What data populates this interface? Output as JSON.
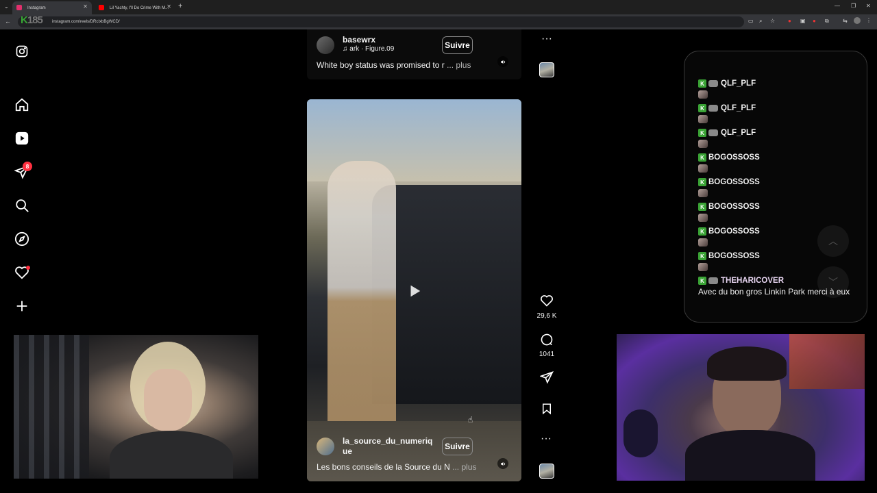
{
  "browser": {
    "tabs": [
      {
        "title": "Instagram",
        "active": true,
        "favicon_color": "#e1306c"
      },
      {
        "title": "Lil Yachty, I'll Do Crime With M...",
        "active": false,
        "favicon_color": "#ff0000"
      }
    ],
    "url": "instagram.com/reels/DRcIxbBgWCD/",
    "overlay_logo": "K",
    "overlay_text": "185"
  },
  "sidebar": {
    "icons": [
      "instagram-logo-icon",
      "home-icon",
      "reels-icon",
      "messages-icon",
      "search-icon",
      "explore-icon",
      "notifications-icon",
      "create-icon"
    ],
    "messages_badge": "8"
  },
  "reel_top": {
    "username": "basewrx",
    "audio_text": "ark · Figure.09",
    "follow_label": "Suivre",
    "caption": "White boy status was promised to r",
    "more_label": "... plus"
  },
  "reel_main": {
    "username": "la_source_du_numerique",
    "follow_label": "Suivre",
    "caption": "Les bons conseils de la Source du N",
    "more_label": "... plus",
    "likes": "29,6 K",
    "comments": "1041"
  },
  "chat": {
    "rows": [
      {
        "user": "QLF_PLF",
        "emote": true
      },
      {
        "user": "QLF_PLF",
        "emote": true
      },
      {
        "user": "QLF_PLF",
        "emote": true
      },
      {
        "user": "BOGOSSOSS",
        "emote": false
      },
      {
        "user": "BOGOSSOSS",
        "emote": false
      },
      {
        "user": "BOGOSSOSS",
        "emote": false
      },
      {
        "user": "BOGOSSOSS",
        "emote": false
      },
      {
        "user": "BOGOSSOSS",
        "emote": false
      }
    ],
    "last_user": "THEHARICOVER",
    "last_message": "Avec du bon gros Linkin Park merci à eux",
    "last_user_color": "#e8d6f2"
  },
  "colors": {
    "background": "#000000",
    "badge": "#ff3040",
    "kick_green": "#3aa335"
  }
}
